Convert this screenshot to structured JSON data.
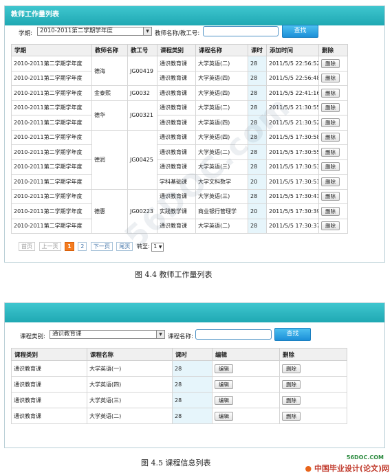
{
  "panel1": {
    "title": "教师工作量列表",
    "term_label": "学期:",
    "term_value": "2010-2011第二学期学年度",
    "teacher_label": "教师名称/教工号:",
    "teacher_input": "",
    "search_label": "查找",
    "columns": [
      "学期",
      "教师名称",
      "教工号",
      "课程类别",
      "课程名称",
      "课时",
      "添加时间",
      "删除"
    ],
    "groups": [
      {
        "teacher": "德海",
        "id": "JG00419",
        "rows": [
          {
            "term": "2010-2011第二学期学年度",
            "type": "通识教育课",
            "course": "大学英语(二)",
            "hours": "28",
            "time": "2011/5/5 22:56:52",
            "del": "删除"
          },
          {
            "term": "2010-2011第二学期学年度",
            "type": "通识教育课",
            "course": "大学英语(四)",
            "hours": "28",
            "time": "2011/5/5 22:56:48",
            "del": "删除"
          }
        ]
      },
      {
        "teacher": "金泰熙",
        "id": "JG0032",
        "rows": [
          {
            "term": "2010-2011第二学期学年度",
            "type": "通识教育课",
            "course": "大学英语(四)",
            "hours": "28",
            "time": "2011/5/5 22:41:16",
            "del": "删除"
          }
        ]
      },
      {
        "teacher": "德华",
        "id": "JG00321",
        "rows": [
          {
            "term": "2010-2011第二学期学年度",
            "type": "通识教育课",
            "course": "大学英语(二)",
            "hours": "28",
            "time": "2011/5/5 21:30:55",
            "del": "删除"
          },
          {
            "term": "2010-2011第二学期学年度",
            "type": "通识教育课",
            "course": "大学英语(四)",
            "hours": "28",
            "time": "2011/5/5 21:30:52",
            "del": "删除"
          }
        ]
      },
      {
        "teacher": "德润",
        "id": "JG00425",
        "rows": [
          {
            "term": "2010-2011第二学期学年度",
            "type": "通识教育课",
            "course": "大学英语(四)",
            "hours": "28",
            "time": "2011/5/5 17:30:58",
            "del": "删除"
          },
          {
            "term": "2010-2011第二学期学年度",
            "type": "通识教育课",
            "course": "大学英语(二)",
            "hours": "28",
            "time": "2011/5/5 17:30:55",
            "del": "删除"
          },
          {
            "term": "2010-2011第二学期学年度",
            "type": "通识教育课",
            "course": "大学英语(三)",
            "hours": "28",
            "time": "2011/5/5 17:30:53",
            "del": "删除"
          },
          {
            "term": "2010-2011第二学期学年度",
            "type": "学科基础课",
            "course": "大学文科数学",
            "hours": "20",
            "time": "2011/5/5 17:30:51",
            "del": "删除"
          }
        ]
      },
      {
        "teacher": "德惠",
        "id": "JG00223",
        "rows": [
          {
            "term": "2010-2011第二学期学年度",
            "type": "通识教育课",
            "course": "大学英语(三)",
            "hours": "28",
            "time": "2011/5/5 17:30:41",
            "del": "删除"
          },
          {
            "term": "2010-2011第二学期学年度",
            "type": "实践教学课",
            "course": "商业银行管理学",
            "hours": "20",
            "time": "2011/5/5 17:30:39",
            "del": "删除"
          },
          {
            "term": "2010-2011第二学期学年度",
            "type": "通识教育课",
            "course": "大学英语(二)",
            "hours": "28",
            "time": "2011/5/5 17:30:37",
            "del": "删除"
          }
        ]
      }
    ],
    "pager": {
      "first": "首页",
      "prev": "上一页",
      "pages": [
        "1",
        "2"
      ],
      "current": "1",
      "next": "下一页",
      "last": "尾页",
      "goto_label": "转至:",
      "goto_value": "1"
    }
  },
  "caption1": "图 4.4   教师工作量列表",
  "panel2": {
    "type_label": "课程类别:",
    "type_value": "通识教育课",
    "course_label": "课程名称:",
    "course_input": "",
    "search_label": "查找",
    "columns": [
      "课程类别",
      "课程名称",
      "课时",
      "编辑",
      "删除"
    ],
    "rows": [
      {
        "type": "通识教育课",
        "course": "大学英语(一)",
        "hours": "28",
        "edit": "编辑",
        "del": "删除"
      },
      {
        "type": "通识教育课",
        "course": "大学英语(四)",
        "hours": "28",
        "edit": "编辑",
        "del": "删除"
      },
      {
        "type": "通识教育课",
        "course": "大学英语(三)",
        "hours": "28",
        "edit": "编辑",
        "del": "删除"
      },
      {
        "type": "通识教育课",
        "course": "大学英语(二)",
        "hours": "28",
        "edit": "编辑",
        "del": "删除"
      }
    ]
  },
  "caption2": "图 4.5   课程信息列表",
  "watermark": "56DOC.com",
  "footer_logo": "中国毕业设计(论文)网",
  "footer_site": "56DOC.COM"
}
